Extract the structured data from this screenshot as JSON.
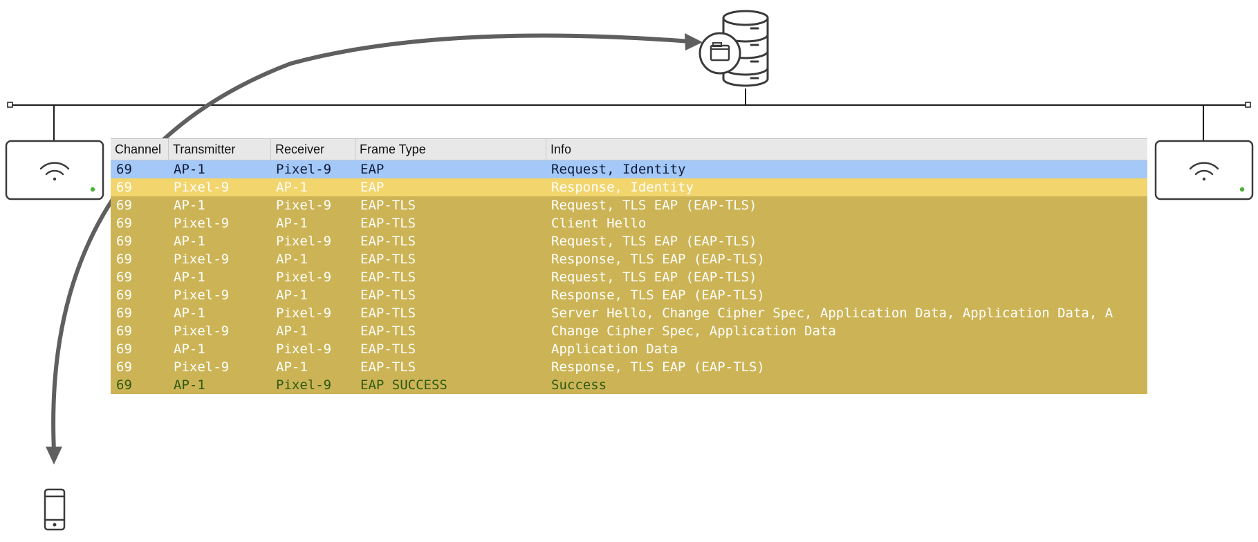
{
  "table": {
    "headers": [
      "Channel",
      "Transmitter",
      "Receiver",
      "Frame Type",
      "Info"
    ],
    "rows": [
      {
        "cells": [
          "69",
          "AP-1",
          "Pixel-9",
          "EAP",
          "Request, Identity"
        ],
        "style": "selected"
      },
      {
        "cells": [
          "69",
          "Pixel-9",
          "AP-1",
          "EAP",
          "Response, Identity"
        ],
        "style": "light"
      },
      {
        "cells": [
          "69",
          "AP-1",
          "Pixel-9",
          "EAP-TLS",
          "Request, TLS EAP (EAP-TLS)"
        ],
        "style": "normal"
      },
      {
        "cells": [
          "69",
          "Pixel-9",
          "AP-1",
          "EAP-TLS",
          "Client Hello"
        ],
        "style": "normal"
      },
      {
        "cells": [
          "69",
          "AP-1",
          "Pixel-9",
          "EAP-TLS",
          "Request, TLS EAP (EAP-TLS)"
        ],
        "style": "normal"
      },
      {
        "cells": [
          "69",
          "Pixel-9",
          "AP-1",
          "EAP-TLS",
          "Response, TLS EAP (EAP-TLS)"
        ],
        "style": "normal"
      },
      {
        "cells": [
          "69",
          "AP-1",
          "Pixel-9",
          "EAP-TLS",
          "Request, TLS EAP (EAP-TLS)"
        ],
        "style": "normal"
      },
      {
        "cells": [
          "69",
          "Pixel-9",
          "AP-1",
          "EAP-TLS",
          "Response, TLS EAP (EAP-TLS)"
        ],
        "style": "normal"
      },
      {
        "cells": [
          "69",
          "AP-1",
          "Pixel-9",
          "EAP-TLS",
          "Server Hello, Change Cipher Spec, Application Data, Application Data, A"
        ],
        "style": "normal"
      },
      {
        "cells": [
          "69",
          "Pixel-9",
          "AP-1",
          "EAP-TLS",
          "Change Cipher Spec, Application Data"
        ],
        "style": "normal"
      },
      {
        "cells": [
          "69",
          "AP-1",
          "Pixel-9",
          "EAP-TLS",
          "Application Data"
        ],
        "style": "normal"
      },
      {
        "cells": [
          "69",
          "Pixel-9",
          "AP-1",
          "EAP-TLS",
          "Response, TLS EAP (EAP-TLS)"
        ],
        "style": "normal"
      },
      {
        "cells": [
          "69",
          "AP-1",
          "Pixel-9",
          "EAP SUCCESS",
          "Success"
        ],
        "style": "success"
      }
    ]
  },
  "row_styles": {
    "selected": {
      "bg": "#a4c8f7",
      "fg": "#0f1b3a"
    },
    "light": {
      "bg": "#f3d56e",
      "fg": "#ffffff"
    },
    "normal": {
      "bg": "#ccb456",
      "fg": "#ffffff"
    },
    "success": {
      "bg": "#ccb456",
      "fg": "#2e5a12"
    }
  },
  "colors": {
    "line": "#1a1a1a",
    "arrow": "#5f5f5f",
    "icon": "#3a3a3a",
    "led": "#4caf3a"
  },
  "icons": {
    "server": "database-server-icon",
    "certificate": "document-icon",
    "access_point": "wifi-icon",
    "phone": "smartphone-icon"
  }
}
